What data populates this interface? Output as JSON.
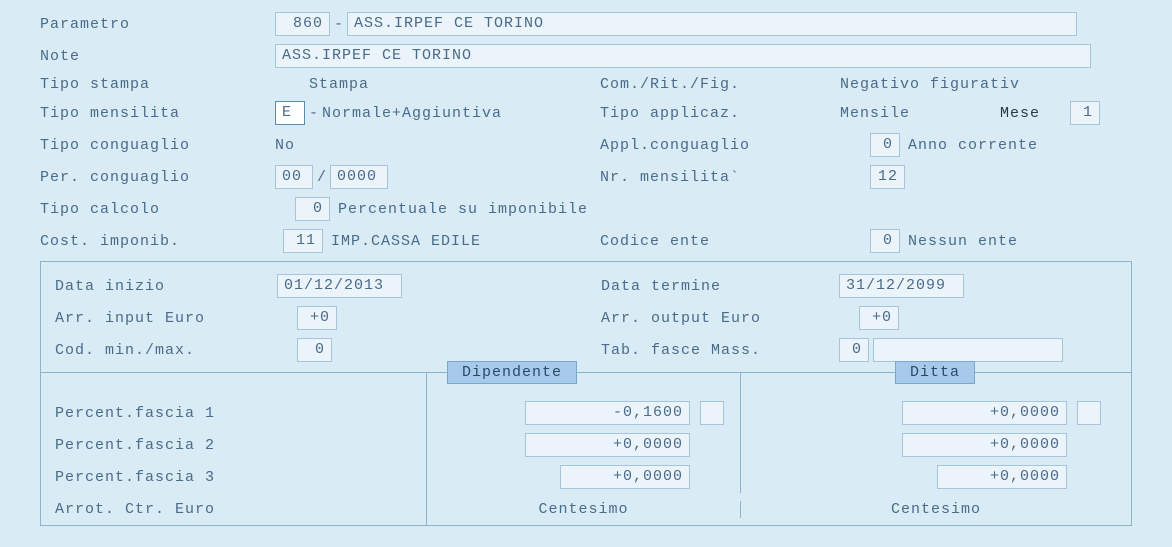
{
  "labels": {
    "parametro": "Parametro",
    "note": "Note",
    "tipo_stampa": "Tipo stampa",
    "com_rit_fig": "Com./Rit./Fig.",
    "tipo_mensilita": "Tipo mensilita",
    "tipo_applicaz": "Tipo applicaz.",
    "mese": "Mese",
    "tipo_conguaglio": "Tipo conguaglio",
    "appl_conguaglio": "Appl.conguaglio",
    "per_conguaglio": "Per. conguaglio",
    "nr_mensilita": "Nr. mensilita`",
    "tipo_calcolo": "Tipo calcolo",
    "cost_imponib": "Cost. imponib.",
    "codice_ente": "Codice ente",
    "data_inizio": "Data inizio",
    "data_termine": "Data termine",
    "arr_input": "Arr. input Euro",
    "arr_output": "Arr. output Euro",
    "cod_min_max": "Cod. min./max.",
    "tab_fasce": "Tab. fasce Mass.",
    "dipendente": "Dipendente",
    "ditta": "Ditta",
    "percent_fascia_1": "Percent.fascia 1",
    "percent_fascia_2": "Percent.fascia 2",
    "percent_fascia_3": "Percent.fascia 3",
    "arrot_ctr": "Arrot. Ctr. Euro",
    "centesimo": "Centesimo"
  },
  "values": {
    "parametro_code": "860",
    "parametro_desc": "ASS.IRPEF CE TORINO",
    "note": "ASS.IRPEF CE TORINO",
    "tipo_stampa": "Stampa",
    "com_rit_fig": "Negativo figurativ",
    "tipo_mensilita_code": "E",
    "tipo_mensilita_desc": "Normale+Aggiuntiva",
    "tipo_applicaz": "Mensile",
    "mese": "1",
    "tipo_conguaglio": "No",
    "appl_conguaglio_code": "0",
    "appl_conguaglio_desc": "Anno corrente",
    "per_conguaglio_mm": "00",
    "per_conguaglio_yyyy": "0000",
    "nr_mensilita": "12",
    "tipo_calcolo_code": "0",
    "tipo_calcolo_desc": "Percentuale su imponibile",
    "cost_imponib_code": "11",
    "cost_imponib_desc": "IMP.CASSA EDILE",
    "codice_ente_code": "0",
    "codice_ente_desc": "Nessun ente",
    "data_inizio": "01/12/2013",
    "data_termine": "31/12/2099",
    "arr_input": "+0",
    "arr_output": "+0",
    "cod_min_max": "0",
    "tab_fasce": "0",
    "fasce": {
      "dipendente": [
        "-0,1600",
        "+0,0000",
        "+0,0000"
      ],
      "ditta": [
        "+0,0000",
        "+0,0000",
        "+0,0000"
      ]
    }
  }
}
